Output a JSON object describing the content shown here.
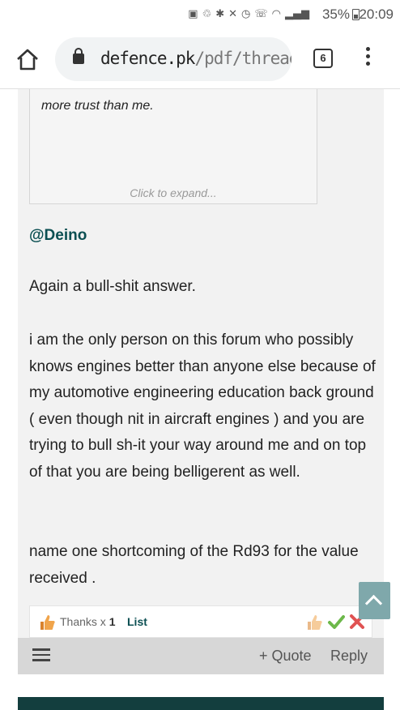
{
  "status_bar": {
    "battery": "35%",
    "time": "20:09"
  },
  "browser": {
    "url_host": "defence.pk",
    "url_path": "/pdf/threads",
    "tab_count": "6"
  },
  "post": {
    "quote_text": "more trust than me.",
    "quote_expand": "Click to expand...",
    "mention": "@Deino",
    "paragraphs": [
      "Again a bull-shit answer.",
      "i am the only person on this forum who possibly knows engines better than anyone else because of my automotive engineering education back ground ( even though nit in aircraft engines ) and you are trying to bull sh-it your way around me and on top of that you are being belligerent as well.",
      "name one shortcoming of the Rd93 for the value received ."
    ],
    "likes": {
      "label": "Thanks x",
      "count": "1",
      "list_link": "List"
    },
    "footer": {
      "quote_label": "+ Quote",
      "reply_label": "Reply"
    }
  },
  "colors": {
    "link": "#0b4f52",
    "post_bg": "#f2f2f2",
    "footer_bg": "#d7d7d7",
    "back_to_top": "#7fa8ab",
    "next_bar": "#133e3e"
  }
}
